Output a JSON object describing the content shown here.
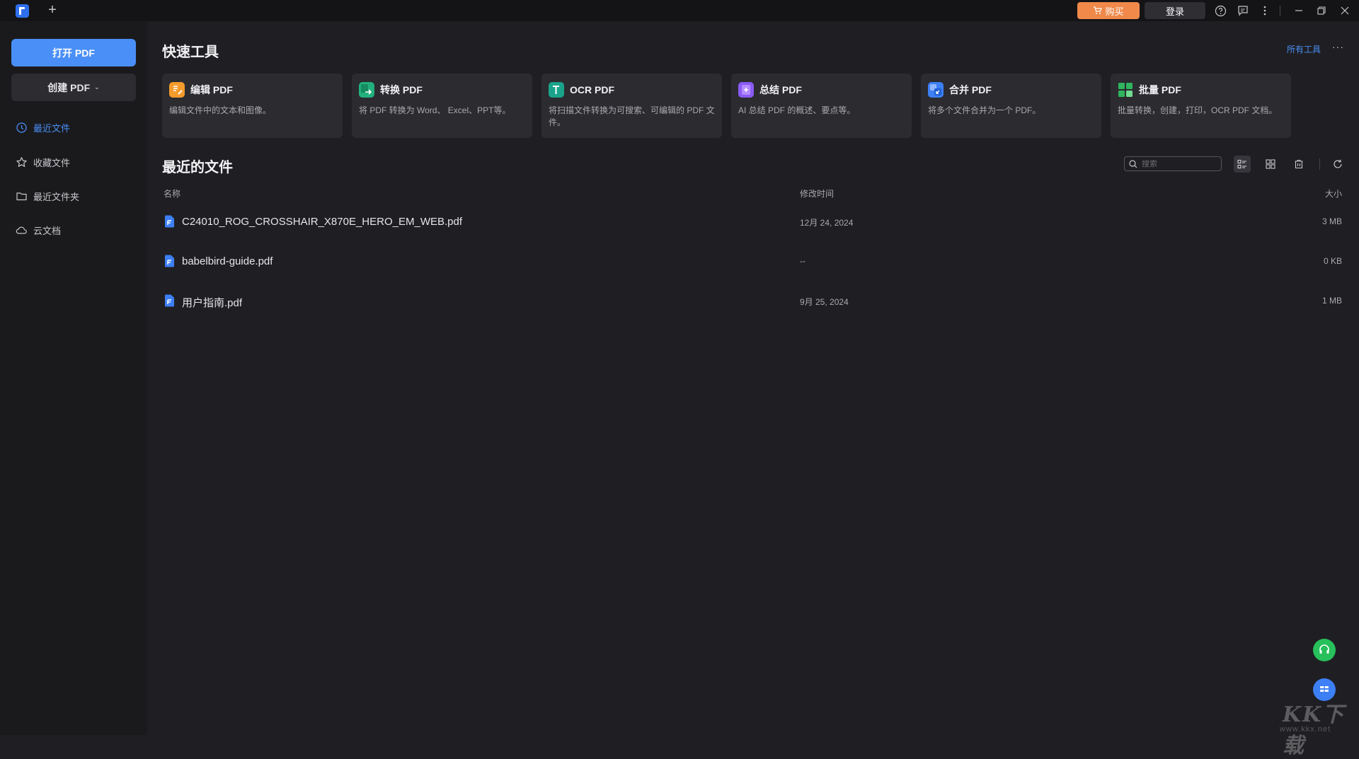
{
  "titlebar": {
    "new_tab": "+",
    "buy_label": "购买",
    "login_label": "登录",
    "icons": [
      "app-logo-icon",
      "cart-icon",
      "help-icon",
      "feedback-icon",
      "more-vertical-icon",
      "minimize-icon",
      "restore-icon",
      "close-icon"
    ]
  },
  "sidebar": {
    "open_label": "打开 PDF",
    "create_label": "创建 PDF",
    "items": [
      {
        "label": "最近文件",
        "icon": "clock-icon",
        "active": true
      },
      {
        "label": "收藏文件",
        "icon": "star-icon",
        "active": false
      },
      {
        "label": "最近文件夹",
        "icon": "folder-icon",
        "active": false
      },
      {
        "label": "云文档",
        "icon": "cloud-icon",
        "active": false
      }
    ]
  },
  "quick_tools": {
    "title": "快速工具",
    "all_tools": "所有工具",
    "more": "···",
    "cards": [
      {
        "name": "编辑 PDF",
        "desc": "编辑文件中的文本和图像。",
        "color": "#f59b2b",
        "icon": "edit-pdf-icon"
      },
      {
        "name": "转换 PDF",
        "desc": "将 PDF 转换为 Word、 Excel、PPT等。",
        "color": "#22b07d",
        "icon": "convert-pdf-icon"
      },
      {
        "name": "OCR PDF",
        "desc": "将扫描文件转换为可搜索、可编辑的 PDF 文件。",
        "color": "#1aa38a",
        "icon": "ocr-pdf-icon"
      },
      {
        "name": "总结 PDF",
        "desc": "AI 总结 PDF 的概述、要点等。",
        "color": "#8a5cf5",
        "icon": "summarize-pdf-icon"
      },
      {
        "name": "合并 PDF",
        "desc": "将多个文件合并为一个 PDF。",
        "color": "#3d7ff5",
        "icon": "merge-pdf-icon"
      },
      {
        "name": "批量 PDF",
        "desc": "批量转换，创建，打印，OCR PDF 文档。",
        "color": "#2fb55e",
        "icon": "batch-pdf-icon"
      }
    ]
  },
  "recent": {
    "title": "最近的文件",
    "search_placeholder": "搜索",
    "columns": {
      "name": "名称",
      "modified": "修改时间",
      "size": "大小"
    },
    "files": [
      {
        "name": "C24010_ROG_CROSSHAIR_X870E_HERO_EM_WEB.pdf",
        "modified": "12月 24, 2024",
        "size": "3 MB"
      },
      {
        "name": "babelbird-guide.pdf",
        "modified": "--",
        "size": "0 KB"
      },
      {
        "name": "用户指南.pdf",
        "modified": "9月 25, 2024",
        "size": "1 MB"
      }
    ]
  },
  "watermark": {
    "big": "KK下载",
    "small": "www.kkx.net"
  }
}
